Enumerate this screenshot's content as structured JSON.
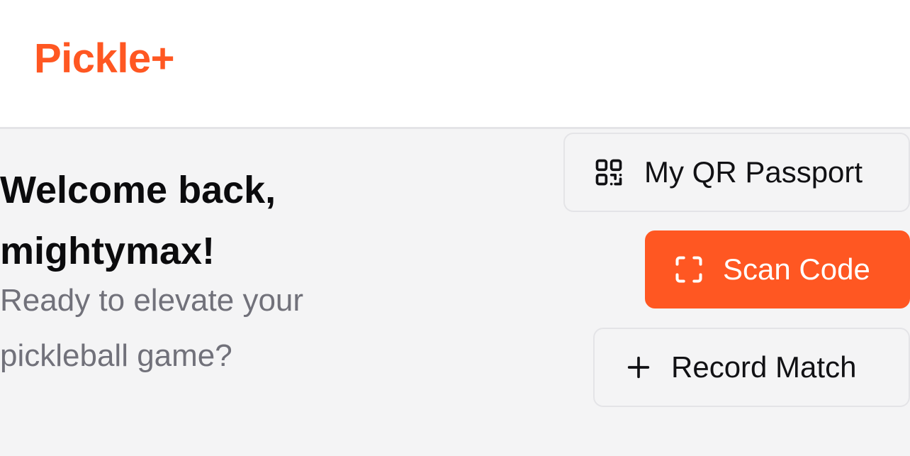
{
  "header": {
    "logo": "Pickle+"
  },
  "welcome": {
    "heading": "Welcome back, mightymax!",
    "subtitle": "Ready to elevate your pickleball game?"
  },
  "actions": {
    "qr_passport": {
      "label": "My QR Passport",
      "icon": "qr-code-icon"
    },
    "scan_code": {
      "label": "Scan Code",
      "icon": "scan-frame-icon"
    },
    "record_match": {
      "label": "Record Match",
      "icon": "plus-icon"
    }
  },
  "colors": {
    "brand": "#ff5722",
    "background": "#f4f4f5",
    "header_bg": "#ffffff",
    "text_primary": "#0b0b0d",
    "text_secondary": "#71717a",
    "border": "#e4e4e7"
  }
}
